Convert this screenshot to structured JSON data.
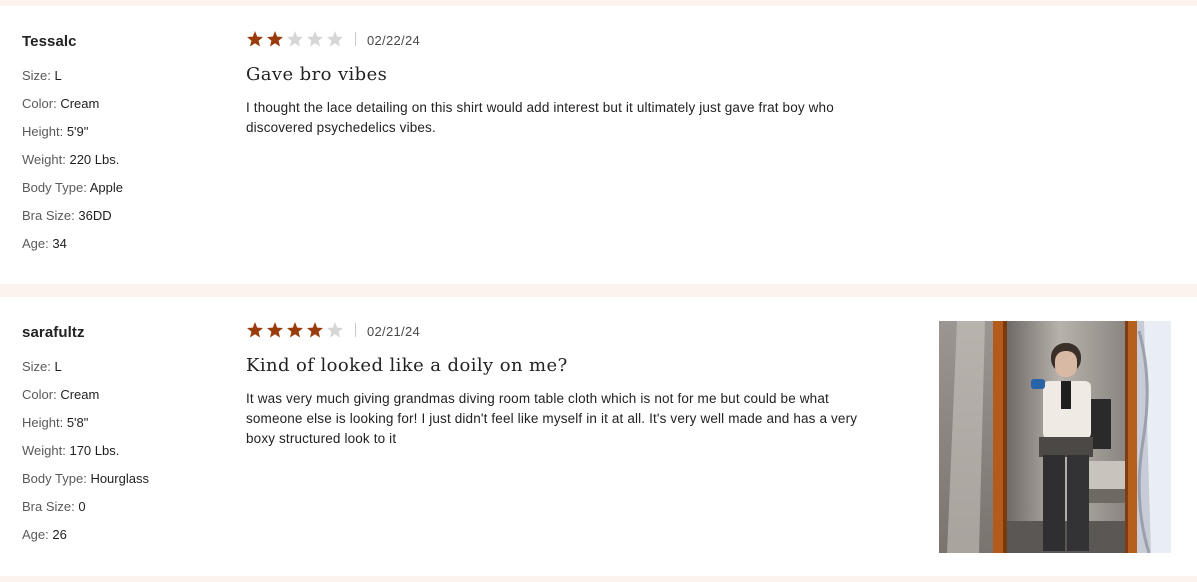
{
  "reviews": [
    {
      "reviewer": "Tessalc",
      "rating": 2,
      "max_rating": 5,
      "date": "02/22/24",
      "title": "Gave bro vibes",
      "body": "I thought the lace detailing on this shirt would add interest but it ultimately just gave frat boy who discovered psychedelics vibes.",
      "attributes": [
        {
          "label": "Size:",
          "value": "L"
        },
        {
          "label": "Color:",
          "value": "Cream"
        },
        {
          "label": "Height:",
          "value": "5'9\""
        },
        {
          "label": "Weight:",
          "value": "220 Lbs."
        },
        {
          "label": "Body Type:",
          "value": "Apple"
        },
        {
          "label": "Bra Size:",
          "value": "36DD"
        },
        {
          "label": "Age:",
          "value": "34"
        }
      ]
    },
    {
      "reviewer": "sarafultz",
      "rating": 4,
      "max_rating": 5,
      "date": "02/21/24",
      "title": "Kind of looked like a doily on me?",
      "body": "It was very much giving grandmas diving room table cloth which is not for me but could be what someone else is looking for! I just didn't feel like myself in it at all. It's very well made and has a very boxy structured look to it",
      "attributes": [
        {
          "label": "Size:",
          "value": "L"
        },
        {
          "label": "Color:",
          "value": "Cream"
        },
        {
          "label": "Height:",
          "value": "5'8\""
        },
        {
          "label": "Weight:",
          "value": "170 Lbs."
        },
        {
          "label": "Body Type:",
          "value": "Hourglass"
        },
        {
          "label": "Bra Size:",
          "value": "0"
        },
        {
          "label": "Age:",
          "value": "26"
        }
      ],
      "photo_icon": "mirror-selfie-photo"
    }
  ],
  "colors": {
    "page_background": "#fcf3ee",
    "star_filled": "#9a3b0c",
    "star_empty": "#d6d6d6"
  }
}
